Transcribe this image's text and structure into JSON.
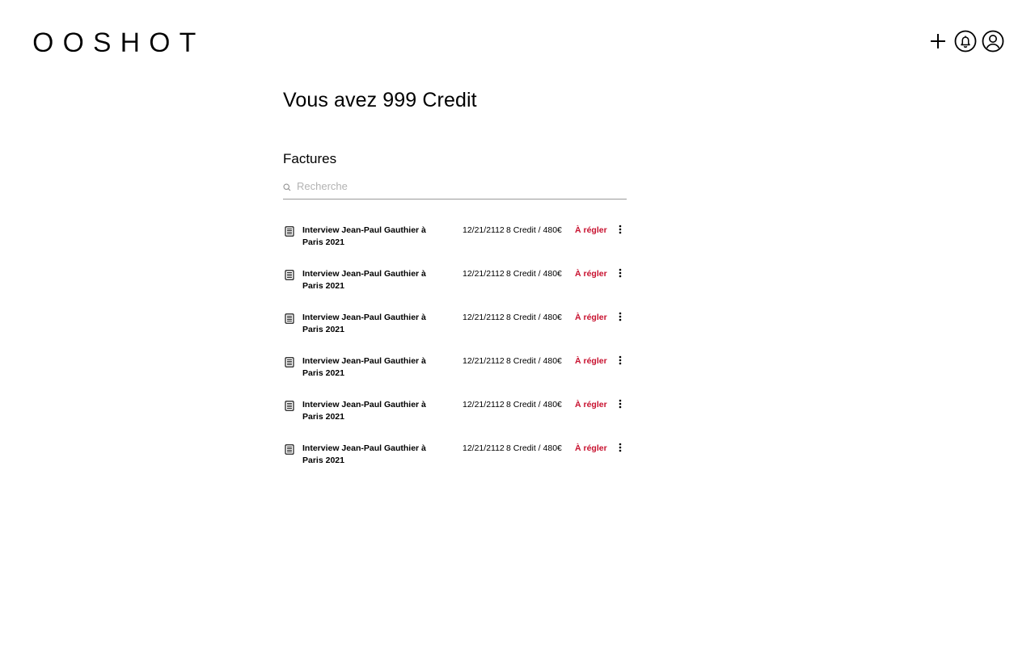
{
  "brand": {
    "logo_text": "OOSHOT"
  },
  "header": {
    "icons": [
      "plus-icon",
      "bell-icon",
      "user-icon"
    ]
  },
  "main": {
    "credit_title": "Vous avez 999 Credit",
    "invoices_title": "Factures",
    "search": {
      "placeholder": "Recherche",
      "value": ""
    },
    "invoices": [
      {
        "title": "Interview Jean-Paul Gauthier à Paris 2021",
        "date": "12/21/2112",
        "amount": "8 Credit / 480€",
        "status": "À régler"
      },
      {
        "title": "Interview Jean-Paul Gauthier à Paris 2021",
        "date": "12/21/2112",
        "amount": "8 Credit / 480€",
        "status": "À régler"
      },
      {
        "title": "Interview Jean-Paul Gauthier à Paris 2021",
        "date": "12/21/2112",
        "amount": "8 Credit / 480€",
        "status": "À régler"
      },
      {
        "title": "Interview Jean-Paul Gauthier à Paris 2021",
        "date": "12/21/2112",
        "amount": "8 Credit / 480€",
        "status": "À régler"
      },
      {
        "title": "Interview Jean-Paul Gauthier à Paris 2021",
        "date": "12/21/2112",
        "amount": "8 Credit / 480€",
        "status": "À régler"
      },
      {
        "title": "Interview Jean-Paul Gauthier à Paris 2021",
        "date": "12/21/2112",
        "amount": "8 Credit / 480€",
        "status": "À régler"
      }
    ]
  },
  "colors": {
    "status_due": "#c8102e",
    "text": "#000000",
    "placeholder": "#b3b3b3",
    "divider": "#9a9a9a"
  }
}
